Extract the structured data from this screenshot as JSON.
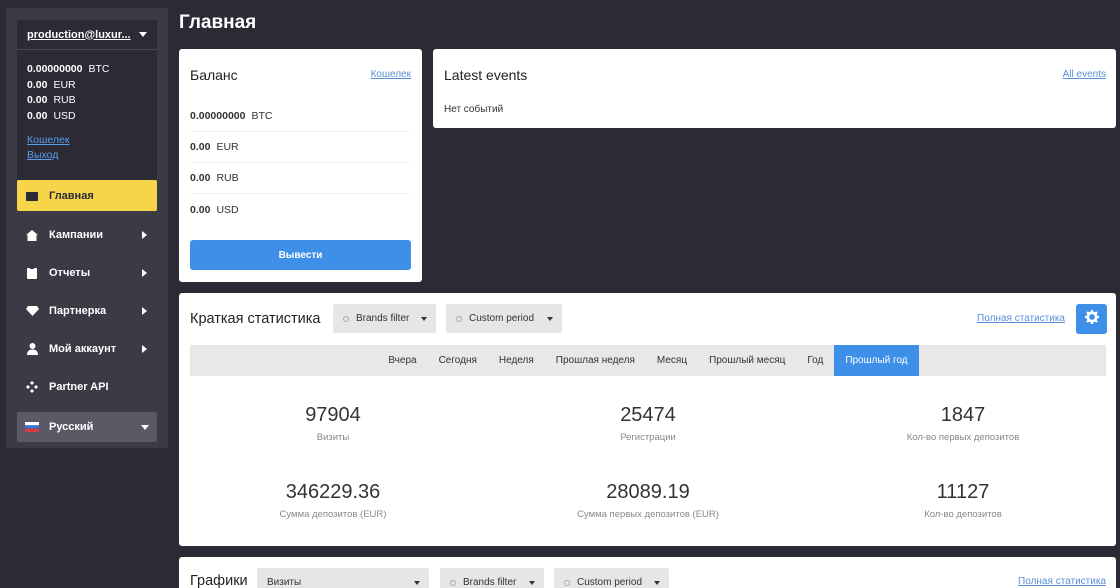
{
  "account": {
    "name": "production@luxur...",
    "balances": [
      {
        "amount": "0.00000000",
        "currency": "BTC"
      },
      {
        "amount": "0.00",
        "currency": "EUR"
      },
      {
        "amount": "0.00",
        "currency": "RUB"
      },
      {
        "amount": "0.00",
        "currency": "USD"
      }
    ],
    "wallet_link": "Кошелек",
    "logout_link": "Выход"
  },
  "nav": {
    "home": "Главная",
    "campaigns": "Кампании",
    "reports": "Отчеты",
    "partner": "Партнерка",
    "my_account": "Мой аккаунт",
    "partner_api": "Partner API",
    "language": "Русский"
  },
  "page_title": "Главная",
  "balance_card": {
    "title": "Баланс",
    "link": "Кошелек",
    "rows": [
      {
        "amount": "0.00000000",
        "currency": "BTC"
      },
      {
        "amount": "0.00",
        "currency": "EUR"
      },
      {
        "amount": "0.00",
        "currency": "RUB"
      },
      {
        "amount": "0.00",
        "currency": "USD"
      }
    ],
    "button": "Вывести"
  },
  "events_card": {
    "title": "Latest events",
    "link": "All events",
    "empty": "Нет событий"
  },
  "stats_card": {
    "title": "Краткая статистика",
    "brands_filter": "Brands filter",
    "custom_period": "Custom period",
    "full_link": "Полная статистика",
    "periods": [
      "Вчера",
      "Сегодня",
      "Неделя",
      "Прошлая неделя",
      "Месяц",
      "Прошлый месяц",
      "Год",
      "Прошлый год"
    ],
    "active_period": "Прошлый год",
    "metrics": [
      {
        "value": "97904",
        "label": "Визиты"
      },
      {
        "value": "25474",
        "label": "Регистрации"
      },
      {
        "value": "1847",
        "label": "Кол-во первых депозитов"
      },
      {
        "value": "346229.36",
        "label": "Сумма депозитов (EUR)"
      },
      {
        "value": "28089.19",
        "label": "Сумма первых депозитов (EUR)"
      },
      {
        "value": "11127",
        "label": "Кол-во депозитов"
      }
    ]
  },
  "charts_card": {
    "title": "Графики",
    "metric_select": "Визиты",
    "brands_filter": "Brands filter",
    "custom_period": "Custom period",
    "full_link": "Полная статистика"
  },
  "colors": {
    "background": "#2b2a35",
    "sidebar": "#3b3a45",
    "accent_yellow": "#f7d54a",
    "accent_blue": "#3d8fe8"
  },
  "icons": {
    "home": "wallet-icon",
    "campaigns": "house-icon",
    "reports": "clipboard-icon",
    "partner": "diamond-icon",
    "my_account": "user-icon",
    "partner_api": "api-icon",
    "language": "flag-icon",
    "settings": "gear-icon"
  }
}
